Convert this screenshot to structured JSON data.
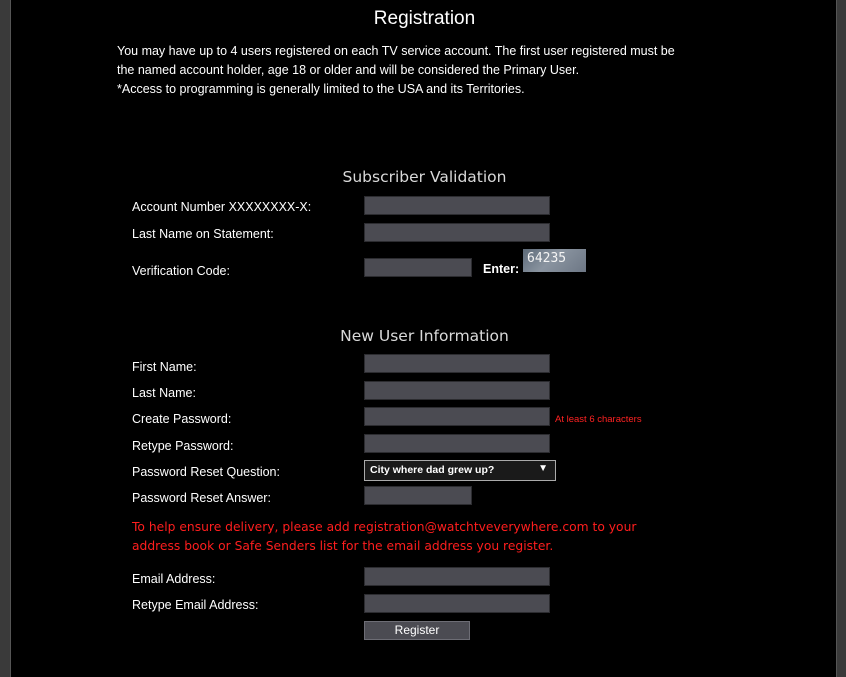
{
  "page": {
    "title": "Registration",
    "intro_lines": [
      "You may have up to 4 users registered on each TV service account. The first user registered must be",
      "the named account holder, age 18 or older and will be considered the Primary User.",
      "*Access to programming is generally limited to the USA and its Territories."
    ]
  },
  "subscriber_validation": {
    "heading": "Subscriber Validation",
    "account_number_label": "Account Number XXXXXXXX-X:",
    "last_name_label": "Last Name on Statement:",
    "verification_label": "Verification Code:",
    "enter_label": "Enter:",
    "captcha_text": "64235"
  },
  "new_user": {
    "heading": "New User Information",
    "first_name_label": "First Name:",
    "last_name_label": "Last Name:",
    "create_password_label": "Create Password:",
    "password_hint": "At least 6 characters",
    "retype_password_label": "Retype Password:",
    "reset_question_label": "Password Reset Question:",
    "reset_question_value": "City where dad grew up?",
    "reset_answer_label": "Password Reset Answer:",
    "notice_lines": [
      "To help ensure delivery, please add registration@watchtveverywhere.com to your",
      "address book or Safe Senders list for the email address you register."
    ],
    "email_label": "Email Address:",
    "retype_email_label": "Retype Email Address:",
    "register_label": "Register"
  },
  "colors": {
    "background": "#000000",
    "field": "#4b4b52",
    "warning": "#ff1e1e"
  }
}
